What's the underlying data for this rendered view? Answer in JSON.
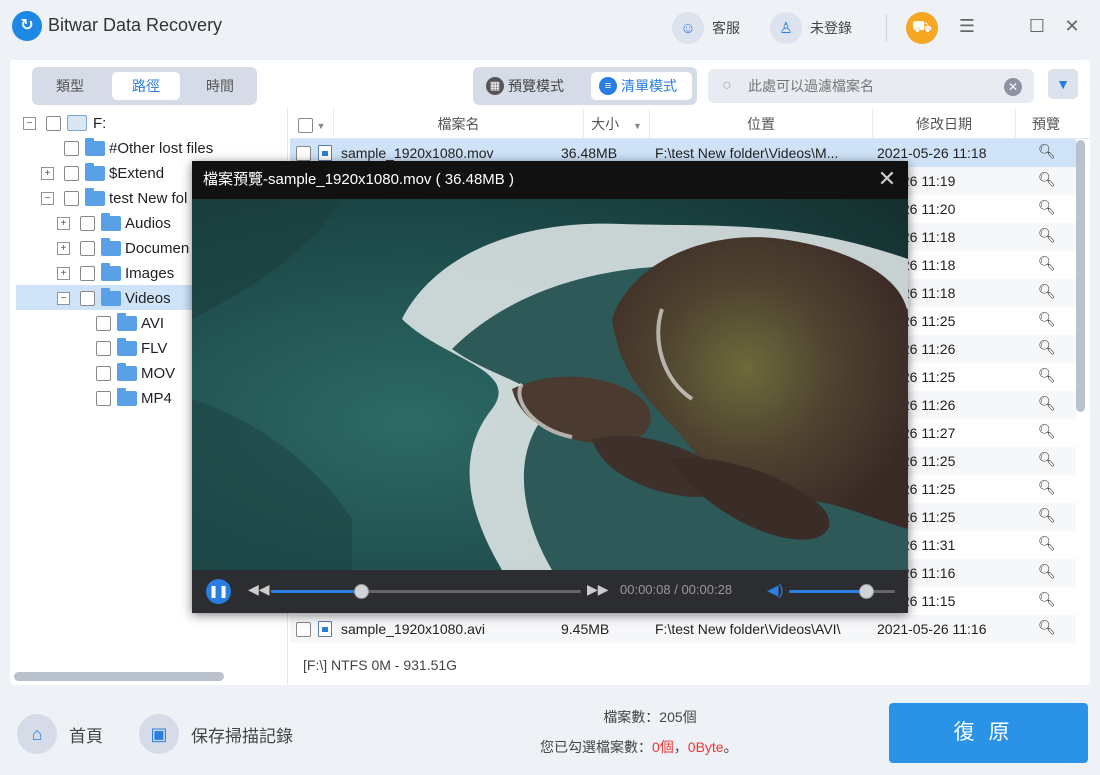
{
  "app": {
    "title": "Bitwar Data Recovery",
    "logo_icon": "bitwar-logo-icon"
  },
  "topbar": {
    "support_label": "客服",
    "login_label": "未登錄"
  },
  "tabs": [
    {
      "label": "類型"
    },
    {
      "label": "路徑"
    },
    {
      "label": "時間"
    }
  ],
  "modes": {
    "preview_label": "預覽模式",
    "list_label": "清單模式"
  },
  "search": {
    "placeholder": "此處可以過濾檔案名"
  },
  "tree": [
    {
      "label": "F:"
    },
    {
      "label": "#Other lost files"
    },
    {
      "label": "$Extend"
    },
    {
      "label": "test New fol"
    },
    {
      "label": "Audios"
    },
    {
      "label": "Documen"
    },
    {
      "label": "Images"
    },
    {
      "label": "Videos"
    },
    {
      "label": "AVI"
    },
    {
      "label": "FLV"
    },
    {
      "label": "MOV"
    },
    {
      "label": "MP4"
    }
  ],
  "table": {
    "headers": {
      "name": "檔案名",
      "size": "大小",
      "location": "位置",
      "modified": "修改日期",
      "preview": "預覽"
    },
    "rows": [
      {
        "name": "sample_1920x1080.mov",
        "size": "36.48MB",
        "location": "F:\\test New folder\\Videos\\M...",
        "modified": "2021-05-26  11:18"
      },
      {
        "name": "",
        "size": "",
        "location": "",
        "modified": "-05-26  11:19"
      },
      {
        "name": "",
        "size": "",
        "location": "",
        "modified": "-05-26  11:20"
      },
      {
        "name": "",
        "size": "",
        "location": "",
        "modified": "-05-26  11:18"
      },
      {
        "name": "",
        "size": "",
        "location": "",
        "modified": "-05-26  11:18"
      },
      {
        "name": "",
        "size": "",
        "location": "",
        "modified": "-05-26  11:18"
      },
      {
        "name": "",
        "size": "",
        "location": "",
        "modified": "-05-26  11:25"
      },
      {
        "name": "",
        "size": "",
        "location": "",
        "modified": "-05-26  11:26"
      },
      {
        "name": "",
        "size": "",
        "location": "",
        "modified": "-05-26  11:25"
      },
      {
        "name": "",
        "size": "",
        "location": "",
        "modified": "-05-26  11:26"
      },
      {
        "name": "",
        "size": "",
        "location": "",
        "modified": "-05-26  11:27"
      },
      {
        "name": "",
        "size": "",
        "location": "",
        "modified": "-05-26  11:25"
      },
      {
        "name": "",
        "size": "",
        "location": "",
        "modified": "-05-26  11:25"
      },
      {
        "name": "",
        "size": "",
        "location": "",
        "modified": "-05-26  11:25"
      },
      {
        "name": "",
        "size": "",
        "location": "",
        "modified": "-05-26  11:31"
      },
      {
        "name": "",
        "size": "",
        "location": "",
        "modified": "-05-26  11:16"
      },
      {
        "name": "",
        "size": "",
        "location": "",
        "modified": "-05-26  11:15"
      },
      {
        "name": "sample_1920x1080.avi",
        "size": "9.45MB",
        "location": "F:\\test New folder\\Videos\\AVI\\",
        "modified": "2021-05-26  11:16"
      }
    ]
  },
  "status": {
    "disk": "[F:\\] NTFS 0M - 931.51G"
  },
  "preview": {
    "title": "檔案預覽-sample_1920x1080.mov ( 36.48MB )",
    "time": "00:00:08 / 00:00:28",
    "progress": 0.29,
    "volume": 0.73
  },
  "bottom": {
    "home_label": "首頁",
    "save_label": "保存掃描記錄",
    "file_count": "檔案數：205個",
    "selected_prefix": "您已勾選檔案數：",
    "selected_count": "0個",
    "separator": "，",
    "selected_size": "0Byte",
    "suffix": "。",
    "recover_label": "復原"
  },
  "colors": {
    "accent": "#2a7de1",
    "recover_button": "#2a93e8",
    "selection": "#cfe3f8",
    "warning_red": "#e53935"
  }
}
